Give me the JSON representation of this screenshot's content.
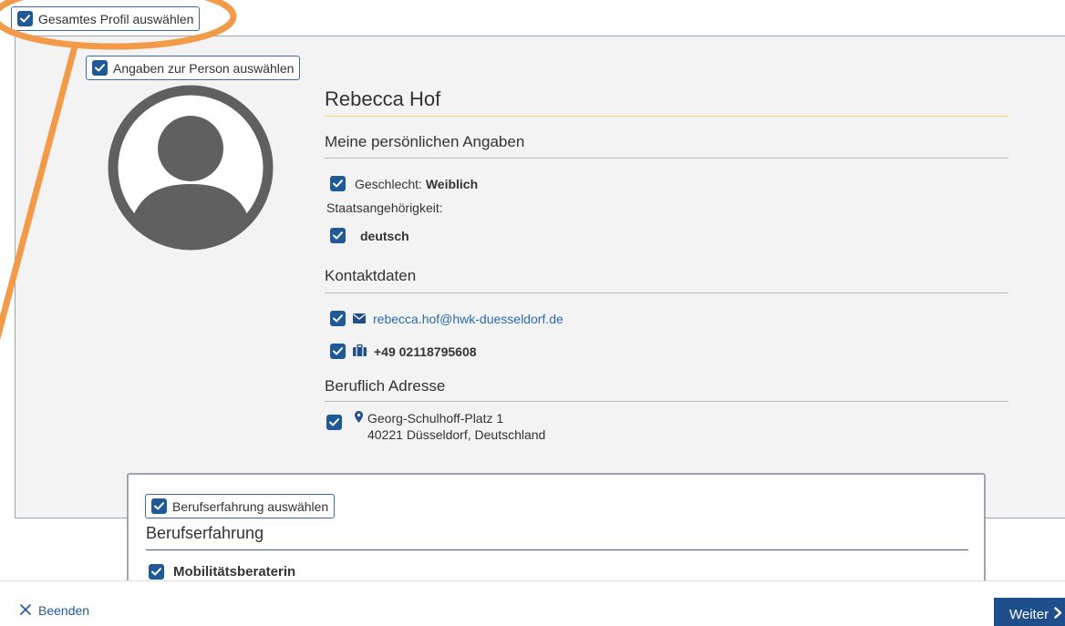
{
  "select_all": {
    "label": "Gesamtes Profil auswählen",
    "checked": true
  },
  "personal": {
    "select_label": "Angaben zur Person auswählen",
    "name": "Rebecca Hof",
    "section_title": "Meine persönlichen Angaben",
    "gender_label": "Geschlecht:",
    "gender_value": "Weiblich",
    "nationality_label": "Staatsangehörigkeit:",
    "nationality_value": "deutsch"
  },
  "contact": {
    "section_title": "Kontaktdaten",
    "email": "rebecca.hof@hwk-duesseldorf.de",
    "phone": "+49 02118795608"
  },
  "address": {
    "section_title": "Beruflich Adresse",
    "street": "Georg-Schulhoff-Platz 1",
    "city": "40221 Düsseldorf, Deutschland"
  },
  "experience": {
    "select_label": "Berufserfahrung auswählen",
    "title": "Berufserfahrung",
    "first_item": "Mobilitätsberaterin"
  },
  "footer": {
    "quit_label": "Beenden",
    "next_label": "Weiter"
  },
  "icons": {
    "checkbox": "checkbox-checked-icon",
    "email": "envelope-icon",
    "phone": "briefcase-icon",
    "address": "map-marker-icon",
    "quit": "close-icon",
    "next": "chevron-right-icon",
    "avatar": "user-avatar-icon"
  },
  "colors": {
    "accent": "#1f5a96",
    "button": "#1f4e8c",
    "link": "#2a6aad",
    "highlight": "#f39a48",
    "name_rule": "#f2d67a"
  }
}
